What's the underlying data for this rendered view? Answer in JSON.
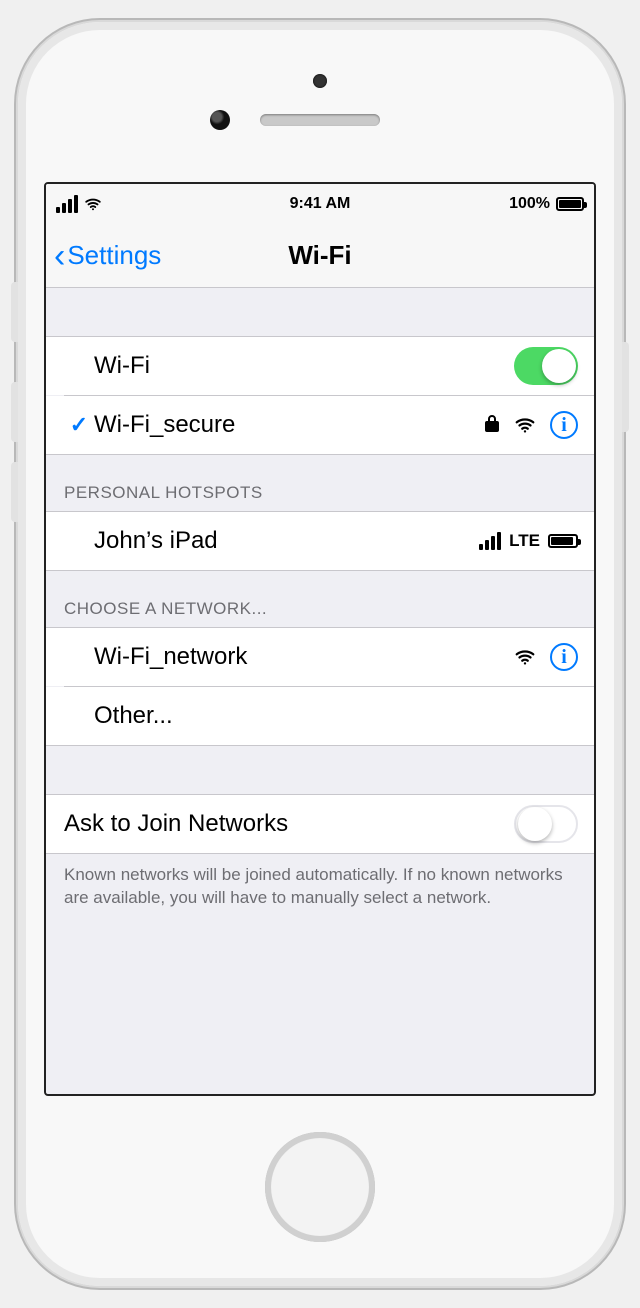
{
  "statusBar": {
    "time": "9:41 AM",
    "batteryPct": "100%"
  },
  "nav": {
    "backLabel": "Settings",
    "title": "Wi-Fi"
  },
  "wifiToggle": {
    "label": "Wi-Fi",
    "on": true
  },
  "connected": {
    "name": "Wi-Fi_secure",
    "locked": true
  },
  "sections": {
    "hotspotsHeader": "PERSONAL HOTSPOTS",
    "chooseHeader": "CHOOSE A NETWORK...",
    "askFooter": "Known networks will be joined automatically. If no known networks are available, you will have to manually select a network."
  },
  "hotspots": [
    {
      "name": "John’s iPad",
      "carrier": "LTE"
    }
  ],
  "networks": [
    {
      "name": "Wi-Fi_network",
      "locked": false
    }
  ],
  "otherLabel": "Other...",
  "askJoin": {
    "label": "Ask to Join Networks",
    "on": false
  }
}
